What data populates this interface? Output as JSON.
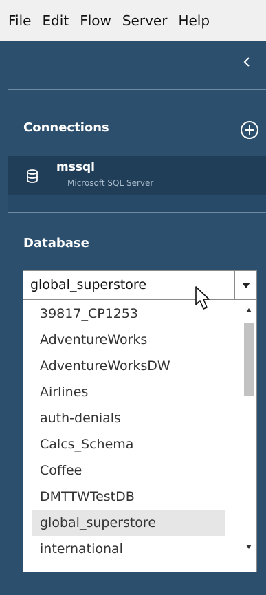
{
  "menubar": {
    "items": [
      "File",
      "Edit",
      "Flow",
      "Server",
      "Help"
    ]
  },
  "sidebar": {
    "collapse_glyph": "<",
    "connections": {
      "title": "Connections",
      "add_icon": "plus-circle-icon",
      "items": [
        {
          "name": "mssql",
          "type": "Microsoft SQL Server",
          "icon": "database-icon"
        }
      ]
    },
    "database": {
      "title": "Database",
      "selected": "global_superstore",
      "options": [
        "39817_CP1253",
        "AdventureWorks",
        "AdventureWorksDW",
        "Airlines",
        "auth-denials",
        "Calcs_Schema",
        "Coffee",
        "DMTTWTestDB",
        "global_superstore",
        "international"
      ],
      "highlighted_option": "global_superstore"
    }
  },
  "colors": {
    "sidebar_bg": "#2d4f6e",
    "connection_row_bg": "#213e59",
    "divider": "#6f8aa3",
    "highlight": "#e6e6e6"
  }
}
